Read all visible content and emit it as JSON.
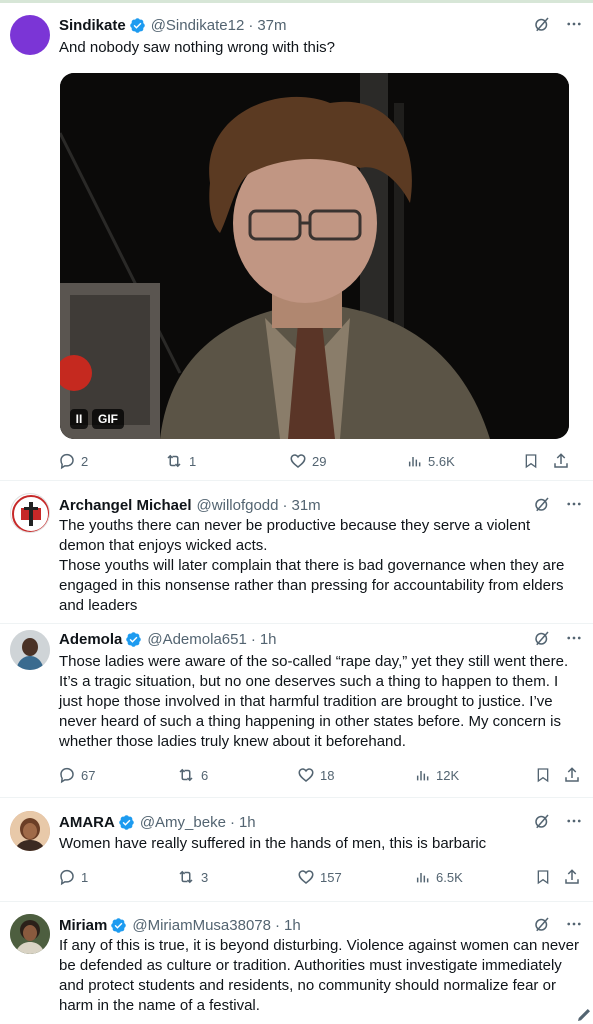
{
  "tweets": [
    {
      "name": "Sindikate",
      "handle": "@Sindikate12",
      "sep": "·",
      "time": "37m",
      "text": "And nobody saw nothing wrong with this?",
      "gif_label": "GIF",
      "pause_label": "II",
      "replies": "2",
      "reposts": "1",
      "likes": "29",
      "views": "5.6K"
    },
    {
      "name": "Archangel Michael",
      "handle": "@willofgodd",
      "sep": "·",
      "time": "31m",
      "line1": "The youths there can never be productive because they serve a violent demon that enjoys wicked acts.",
      "line2": "Those youths will later complain that there is bad governance when they are engaged in this nonsense rather than pressing for accountability from elders and leaders"
    },
    {
      "name": "Ademola",
      "handle": "@Ademola651",
      "sep": "·",
      "time": "1h",
      "text": "Those ladies were aware of the so-called “rape day,” yet they still went there. It’s a tragic situation, but no one deserves such a thing to happen to them. I just hope those involved in that harmful tradition are brought to justice. I’ve never heard of such a thing happening in other states before. My concern is whether those ladies truly knew about it beforehand.",
      "replies": "67",
      "reposts": "6",
      "likes": "18",
      "views": "12K"
    },
    {
      "name": "AMARA",
      "handle": "@Amy_beke",
      "sep": "·",
      "time": "1h",
      "text": "Women have really suffered in the hands of men, this is barbaric",
      "replies": "1",
      "reposts": "3",
      "likes": "157",
      "views": "6.5K"
    },
    {
      "name": "Miriam",
      "handle": "@MiriamMusa38078",
      "sep": "·",
      "time": "1h",
      "text": "If any of this is true, it is beyond disturbing. Violence against women can never be defended as culture or tradition. Authorities must investigate immediately and protect students and residents, no community should normalize fear or harm in the name of a festival."
    }
  ],
  "colors": {
    "text": "#0f1419",
    "secondary": "#536471",
    "verified": "#1d9bf0",
    "border": "#eff3f4"
  }
}
